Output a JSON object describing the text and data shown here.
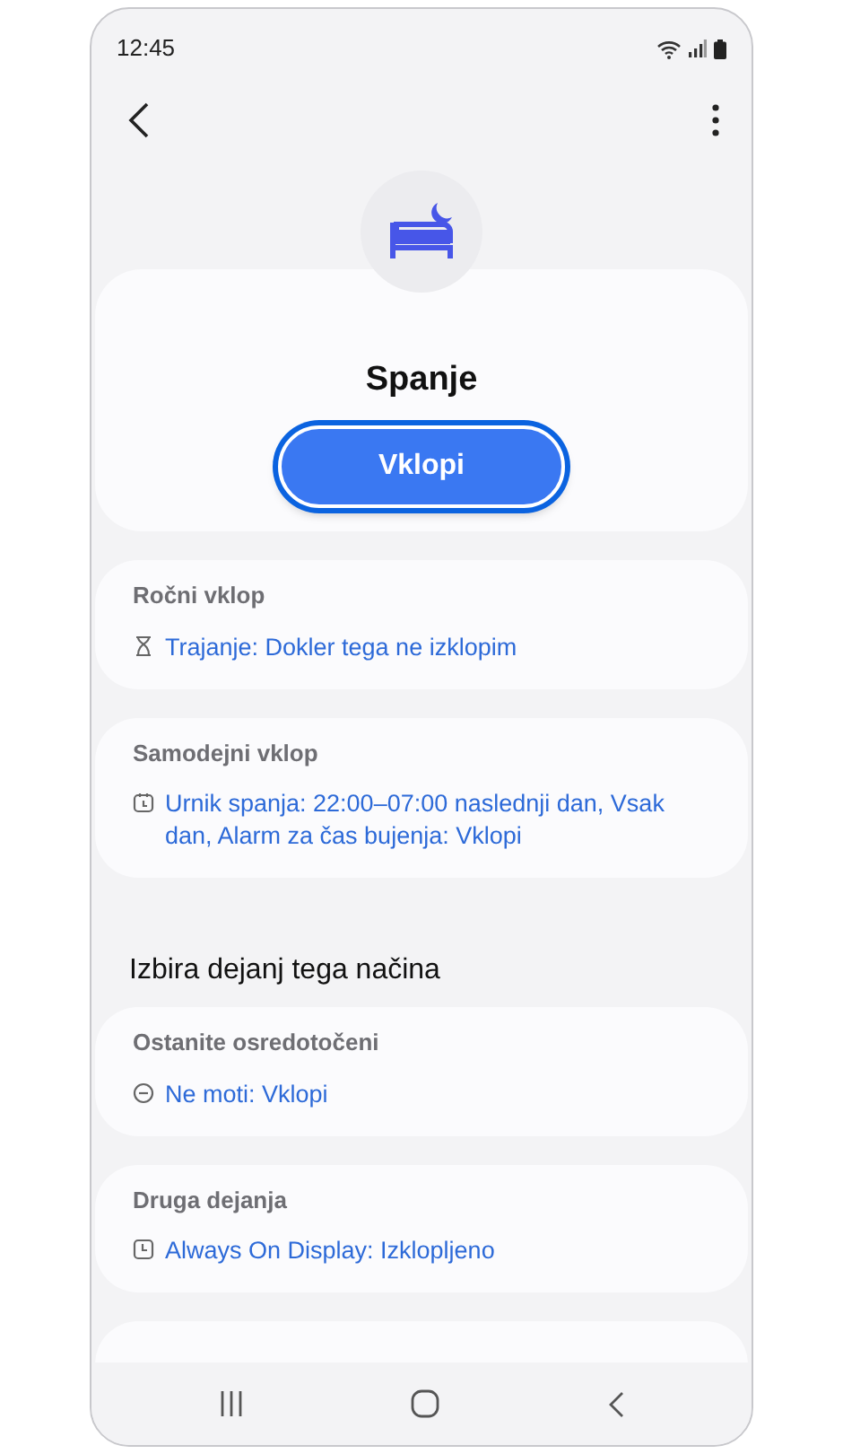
{
  "status_bar": {
    "time": "12:45"
  },
  "mode": {
    "title": "Spanje",
    "button": "Vklopi"
  },
  "blocks": [
    {
      "kind": "card",
      "title": "Ročni vklop",
      "item": {
        "kind": "duration",
        "text": "Trajanje: Dokler tega ne izklopim"
      }
    },
    {
      "kind": "card",
      "title": "Samodejni vklop",
      "item": {
        "kind": "schedule",
        "text": "Urnik spanja: 22:00–07:00 naslednji dan, Vsak dan, Alarm za čas bujenja: Vklopi"
      }
    },
    {
      "kind": "heading",
      "title": "Izbira dejanj tega načina"
    },
    {
      "kind": "card",
      "title": "Ostanite osredotočeni",
      "item": {
        "kind": "dnd",
        "text": "Ne moti: Vklopi"
      }
    },
    {
      "kind": "card",
      "title": "Druga dejanja",
      "item": {
        "kind": "display",
        "text": "Always On Display: Izklopljeno"
      }
    }
  ]
}
